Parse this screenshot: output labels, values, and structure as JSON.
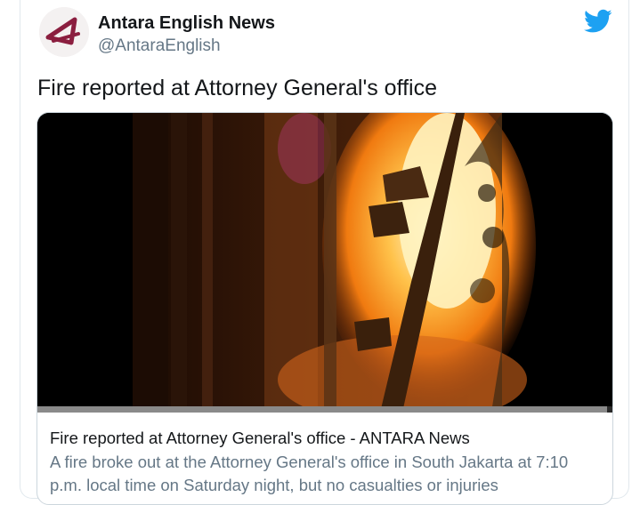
{
  "tweet": {
    "author_name": "Antara English News",
    "author_handle": "@AntaraEnglish",
    "text": "Fire reported at Attorney General's office"
  },
  "link_card": {
    "title": "Fire reported at Attorney General's office - ANTARA News",
    "description": "A fire broke out at the Attorney General's office in South Jakarta at 7:10 p.m. local time on Saturday night, but no casualties or injuries",
    "video_progress_fraction": 0.99
  },
  "icons": {
    "twitter_logo": "twitter-bird-icon",
    "avatar_logo": "antara-logo"
  },
  "colors": {
    "twitter_blue": "#1da1f2",
    "antara_maroon": "#8b1e3f",
    "handle_gray": "#657786"
  }
}
